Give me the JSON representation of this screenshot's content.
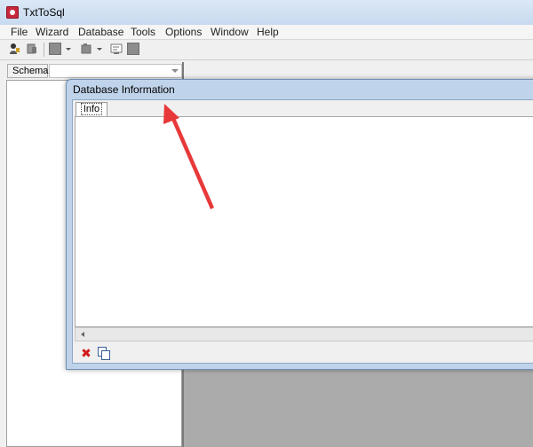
{
  "window": {
    "title": "TxtToSql"
  },
  "menu": {
    "items": [
      "File",
      "Wizard",
      "Database",
      "Tools",
      "Options",
      "Window",
      "Help"
    ]
  },
  "toolbar": {
    "icons": [
      "connect-icon",
      "disconnect-icon",
      "table-icon",
      "dropdown-arrow-icon",
      "script-icon",
      "dropdown-arrow-icon",
      "query-icon",
      "stop-icon"
    ]
  },
  "schema": {
    "label": "Schema",
    "selected": ""
  },
  "dialog": {
    "title": "Database Information",
    "tabs": [
      "Info"
    ]
  },
  "colors": {
    "annotation_arrow": "#e8393a"
  }
}
